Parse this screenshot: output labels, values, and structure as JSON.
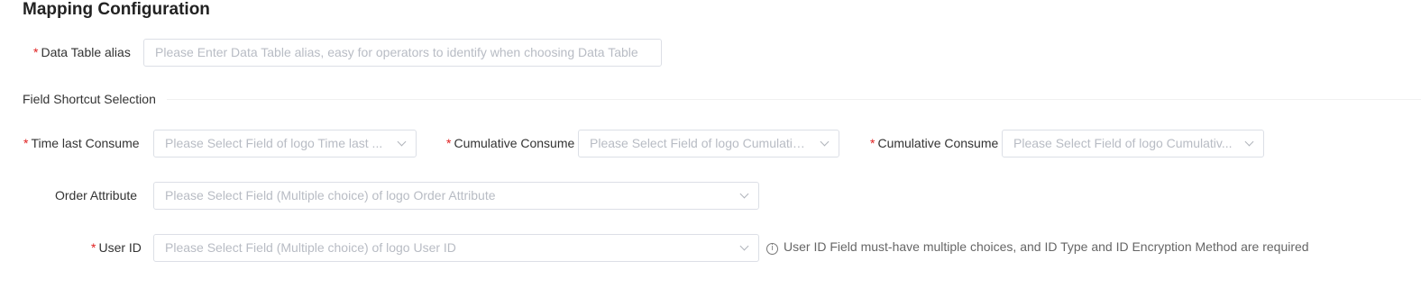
{
  "page": {
    "title": "Mapping Configuration"
  },
  "form": {
    "alias": {
      "label": "Data Table alias",
      "placeholder": "Please Enter Data Table alias, easy for operators to identify when choosing Data Table"
    },
    "section_title": "Field Shortcut Selection",
    "time_last_consume": {
      "label": "Time last Consume",
      "placeholder": "Please Select Field of logo Time last ..."
    },
    "cumulative_consume_1": {
      "label": "Cumulative Consume",
      "placeholder": "Please Select Field of logo Cumulativ..."
    },
    "cumulative_consume_2": {
      "label": "Cumulative Consume",
      "placeholder": "Please Select Field of logo Cumulativ..."
    },
    "order_attribute": {
      "label": "Order Attribute",
      "placeholder": "Please Select Field (Multiple choice) of logo Order Attribute"
    },
    "user_id": {
      "label": "User ID",
      "placeholder": "Please Select Field (Multiple choice) of logo User ID",
      "hint": "User ID Field must-have multiple choices, and ID Type and ID Encryption Method are required"
    },
    "required_mark": "*",
    "info_glyph": "i"
  }
}
